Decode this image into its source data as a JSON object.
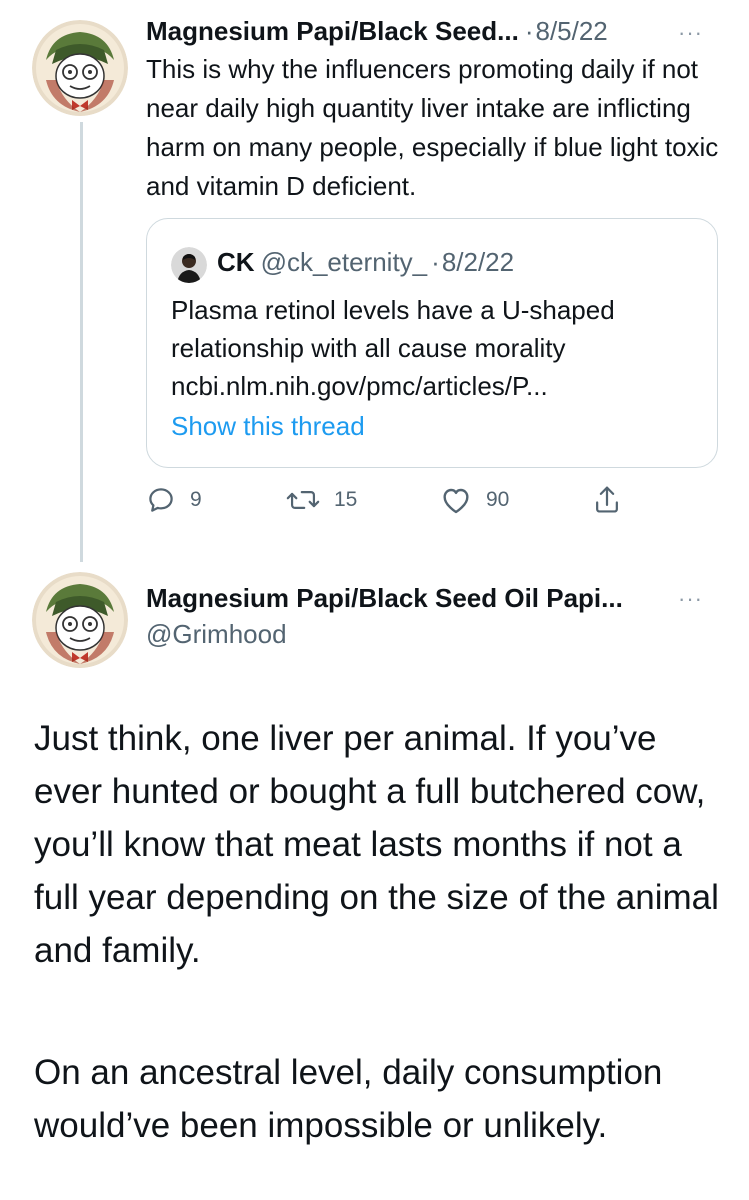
{
  "reply_tweet": {
    "author_name": "Magnesium Papi/Black Seed...",
    "separator": "·",
    "date": "8/5/22",
    "more_label": "···",
    "text": "This is why the influencers promoting daily if not near daily high quantity liver intake are inflicting harm on many people, especially if blue light toxic and vitamin D deficient.",
    "avatar_icon": "cartoon-avatar-icon",
    "quoted_tweet": {
      "author_name": "CK",
      "handle": "@ck_eternity_",
      "separator": "·",
      "date": "8/2/22",
      "text_line1": "Plasma retinol levels have a U-shaped",
      "text_line2": "relationship with all cause morality",
      "link": "ncbi.nlm.nih.gov/pmc/articles/P...",
      "show_thread": "Show this thread"
    },
    "actions": {
      "replies": "9",
      "retweets": "15",
      "likes": "90"
    }
  },
  "main_tweet": {
    "author_name": "Magnesium Papi/Black Seed Oil Papi...",
    "handle": "@Grimhood",
    "more_label": "···",
    "paragraph1": "Just think, one liver per animal. If you’ve ever hunted or bought a full butchered cow, you’ll know that meat lasts months if not a full year depending on the size of the animal and family.",
    "paragraph2": "On an ancestral level, daily consumption would’ve been impossible or unlikely."
  },
  "colors": {
    "text": "#0f1419",
    "secondary": "#536471",
    "link": "#1d9bf0",
    "border": "#cfd9de"
  }
}
